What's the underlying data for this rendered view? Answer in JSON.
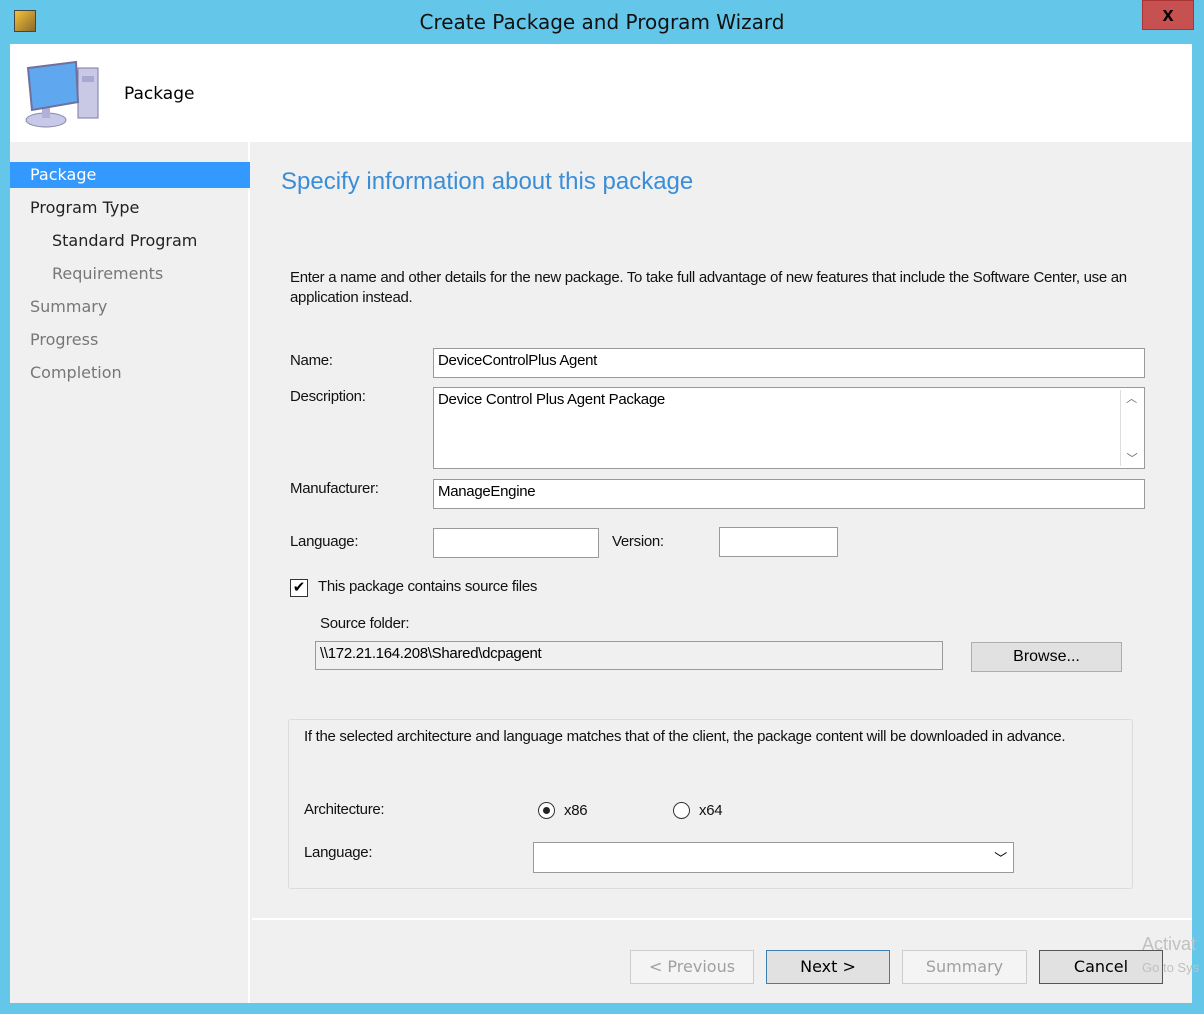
{
  "window": {
    "title": "Create Package and Program Wizard",
    "close": "x"
  },
  "header": {
    "title": "Package"
  },
  "sidebar": {
    "items": [
      {
        "label": "Package"
      },
      {
        "label": "Program Type"
      },
      {
        "label": "Standard Program"
      },
      {
        "label": "Requirements"
      },
      {
        "label": "Summary"
      },
      {
        "label": "Progress"
      },
      {
        "label": "Completion"
      }
    ]
  },
  "main": {
    "title": "Specify information about this package",
    "intro": "Enter a name and other details for the new package. To take full advantage of new features that include the Software Center, use an application instead.",
    "name_label": "Name:",
    "name_value": "DeviceControlPlus Agent",
    "description_label": "Description:",
    "description_value": "Device Control Plus Agent Package",
    "manufacturer_label": "Manufacturer:",
    "manufacturer_value": "ManageEngine",
    "language_label": "Language:",
    "language_value": "",
    "version_label": "Version:",
    "version_value": "",
    "source_checkbox_label": "This package contains source files",
    "source_checked": true,
    "source_folder_label": "Source folder:",
    "source_folder_value": "\\\\172.21.164.208\\Shared\\dcpagent",
    "browse_label": "Browse...",
    "group_text": "If the selected architecture and language matches that of the client, the package content will be downloaded in advance.",
    "architecture_label": "Architecture:",
    "x86_label": "x86",
    "x64_label": "x64",
    "architecture_selected": "x86",
    "group_language_label": "Language:",
    "group_language_value": ""
  },
  "footer": {
    "previous": "< Previous",
    "next": "Next >",
    "summary": "Summary",
    "cancel": "Cancel"
  },
  "watermark": {
    "line1": "Activat",
    "line2": "Go to Sys"
  }
}
